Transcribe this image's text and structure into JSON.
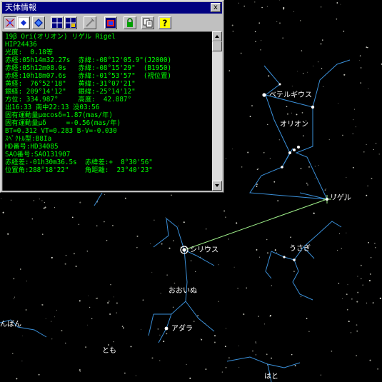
{
  "window": {
    "title": "天体情報",
    "close_label": "x"
  },
  "toolbar": {
    "buttons": [
      {
        "icon": "constellation-lines-icon",
        "pressed": true
      },
      {
        "icon": "star-marker-icon",
        "pressed": false
      },
      {
        "icon": "diamond-icon",
        "pressed": false
      },
      {
        "icon": "grid-icon",
        "pressed": false
      },
      {
        "icon": "grid-lock-icon",
        "pressed": false
      },
      {
        "icon": "wand-icon",
        "pressed": false
      },
      {
        "icon": "image-window-icon",
        "pressed": false
      },
      {
        "icon": "lock-icon",
        "pressed": false
      },
      {
        "icon": "copy-icon",
        "pressed": false
      },
      {
        "icon": "help-icon",
        "pressed": false
      }
    ],
    "help_label": "?"
  },
  "info": {
    "lines": [
      "19β Ori(オリオン) リゲル Rigel",
      "HIP24436",
      "光度:  0.18等",
      "赤経:05h14m32.27s  赤緯:-08°12'05.9\"(J2000)",
      "赤経:05h12m08.0s   赤緯:-08°15'29\"  (B1950)",
      "赤経:10h18m07.6s   赤緯:-01°53'57\"  (視位置)",
      "黄経:  76°52'18\"   黄緯:-31°07'21\"",
      "銀経: 209°14'12\"   銀緯:-25°14'12\"",
      "方位: 334.987°     高度:  42.887°",
      "出16:33 南中22:13 没03:56",
      "固有運動量μαcosδ=1.87(mas/年)",
      "固有運動量μδ     =-0.56(mas/年)",
      "BT=0.312 VT=0.283 B-V=-0.030",
      "ｽﾍﾟｸﾄﾙ型:B8Ia",
      "HD番号:HD34085",
      "SAO番号:SAO131907",
      "赤経差:-01h30m36.5s  赤緯差:+  8°30'56\"",
      "位置角:288°18'22\"    角距離:  23°40'23\""
    ]
  },
  "sky": {
    "labels": {
      "betelgeuse": "ベテルギウス",
      "orion": "オリオン",
      "rigel": "リゲル",
      "sirius": "シリウス",
      "lepus": "うさぎ",
      "canis_major": "おおいぬ",
      "adhara": "アダラ",
      "left_edge": "んばん",
      "puppis": "とも",
      "columba": "はと"
    }
  },
  "colors": {
    "background": "#000000",
    "constellation_line": "#3a8fd8",
    "measure_line": "#9ff08a",
    "info_text": "#00ff00",
    "title_bar": "#000080"
  }
}
